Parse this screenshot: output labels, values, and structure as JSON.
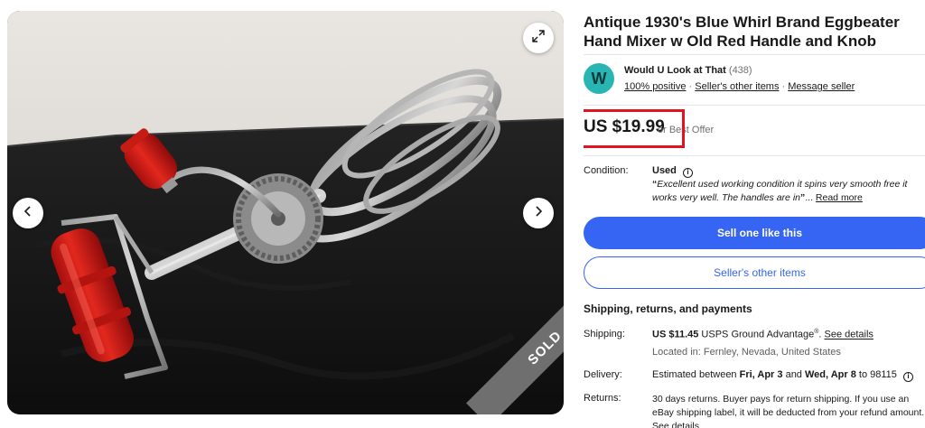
{
  "gallery": {
    "sold_label": "SOLD"
  },
  "listing": {
    "title": "Antique 1930's Blue Whirl Brand Eggbeater Hand Mixer w Old Red Handle and Knob"
  },
  "seller": {
    "avatar_letter": "W",
    "name": "Would U Look at That",
    "feedback_count": "(438)",
    "positive": "100% positive",
    "sep1": " · ",
    "other_items": "Seller's other items",
    "sep2": " · ",
    "message": "Message seller"
  },
  "price": {
    "amount": "US $19.99",
    "best_offer": "or Best Offer"
  },
  "condition": {
    "label": "Condition:",
    "value": "Used",
    "info_glyph": "i",
    "open_quote": "“",
    "description": "Excellent used working condition it spins very smooth free it works very well. The handles are in",
    "close_quote": "”",
    "ellipsis": "... ",
    "read_more": "Read more"
  },
  "buttons": {
    "sell_one": "Sell one like this",
    "sellers_other_items": "Seller's other items"
  },
  "shipping_section": {
    "heading": "Shipping, returns, and payments",
    "shipping_label": "Shipping:",
    "shipping_cost": "US $11.45",
    "shipping_service": " USPS Ground Advantage",
    "shipping_reg": "®",
    "shipping_period": ". ",
    "see_details": "See details",
    "located": "Located in: Fernley, Nevada, United States",
    "delivery_label": "Delivery:",
    "delivery_prefix": "Estimated between ",
    "delivery_start": "Fri, Apr 3",
    "delivery_and": " and ",
    "delivery_end": "Wed, Apr 8",
    "delivery_suffix": " to 98115",
    "returns_label": "Returns:",
    "returns_text": "30 days returns. Buyer pays for return shipping. If you use an eBay shipping label, it will be deducted from your refund amount.",
    "returns_see_details": "See details"
  },
  "colors": {
    "accent_blue": "#3665f3",
    "highlight_red": "#e0141e",
    "avatar_teal": "#2ab5b5",
    "sold_ribbon": "#6f6f6f"
  },
  "icons": {
    "expand": "expand-icon",
    "prev": "chevron-left-icon",
    "next": "chevron-right-icon",
    "info": "info-icon"
  }
}
